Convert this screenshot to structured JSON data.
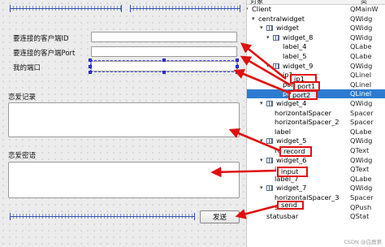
{
  "form": {
    "label_client_id": "要连接的客户端ID",
    "label_client_port": "要连接的客户端Port",
    "label_my_port": "我的端口",
    "label_record": "恋爱记录",
    "label_input": "恋爱密语",
    "send_button": "发送"
  },
  "inspector": {
    "header_object": "对象",
    "header_class": "类",
    "rows": [
      {
        "name": "Client",
        "cls": "QMainW"
      },
      {
        "name": "centralwidget",
        "cls": "QWidg"
      },
      {
        "name": "widget",
        "cls": "QWidg"
      },
      {
        "name": "widget_8",
        "cls": "QWidg"
      },
      {
        "name": "label_4",
        "cls": "QLabe"
      },
      {
        "name": "label_5",
        "cls": "QLabe"
      },
      {
        "name": "widget_9",
        "cls": "QWidg"
      },
      {
        "name": "ip1",
        "cls": "QLinel"
      },
      {
        "name": "port1",
        "cls": "QLinel"
      },
      {
        "name": "port2",
        "cls": "QLinel"
      },
      {
        "name": "widget_4",
        "cls": "QWidg"
      },
      {
        "name": "horizontalSpacer",
        "cls": "Spacer"
      },
      {
        "name": "horizontalSpacer_2",
        "cls": "Spacer"
      },
      {
        "name": "label",
        "cls": "QLabe"
      },
      {
        "name": "widget_5",
        "cls": "QWidg"
      },
      {
        "name": "record",
        "cls": "QText"
      },
      {
        "name": "widget_6",
        "cls": "QWidg"
      },
      {
        "name": "input",
        "cls": "QText"
      },
      {
        "name": "label_7",
        "cls": "QLabe"
      },
      {
        "name": "widget_7",
        "cls": "QWidg"
      },
      {
        "name": "horizontalSpacer_3",
        "cls": "Spacer"
      },
      {
        "name": "send",
        "cls": "QPush"
      },
      {
        "name": "statusbar",
        "cls": "QStat"
      }
    ]
  },
  "watermark": "CSDN @白鹿第",
  "colors": {
    "selection": "#2d7bd1",
    "annotation": "#e01010",
    "spacer": "#2f4fb0"
  }
}
